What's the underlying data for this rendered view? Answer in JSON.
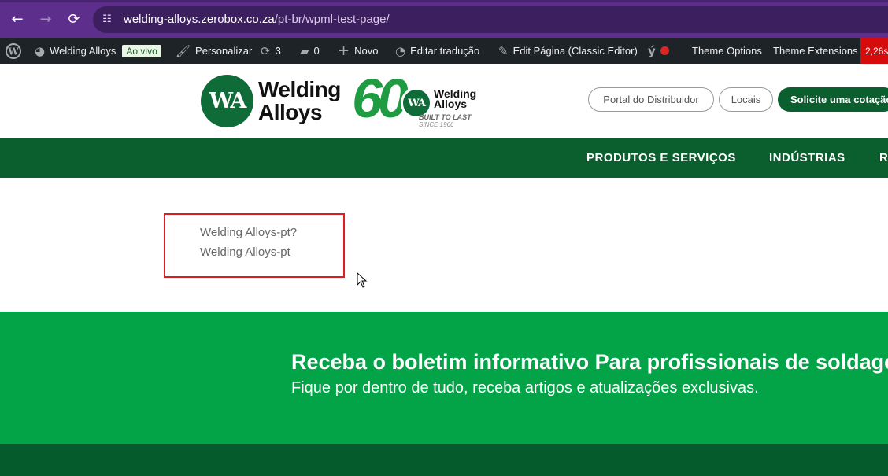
{
  "browser": {
    "url_host": "welding-alloys.zerobox.co.za",
    "url_path": "/pt-br/wpml-test-page/",
    "icons": {
      "back": "arrow-left-icon",
      "forward": "arrow-right-icon",
      "reload": "reload-icon",
      "site_info": "tune-icon"
    }
  },
  "adminbar": {
    "site_name": "Welding Alloys",
    "live_badge": "Ao vivo",
    "customize": "Personalizar",
    "updates_count": "3",
    "comments_count": "0",
    "new": "Novo",
    "edit_translation": "Editar tradução",
    "edit_page": "Edit Página (Classic Editor)",
    "theme_options": "Theme Options",
    "theme_extensions": "Theme Extensions",
    "perf": "2,26s",
    "colors": {
      "bg": "#1d2327",
      "perf_bg": "#d60c0c"
    }
  },
  "header": {
    "logo_mark": "WA",
    "logo_line1": "Welding",
    "logo_line2": "Alloys",
    "badge_number": "60",
    "badge_mark": "WA",
    "badge_line1": "Welding",
    "badge_line2": "Alloys",
    "badge_tagline": "BUILT TO LAST",
    "badge_since": "SINCE 1966",
    "buttons": {
      "distributor_portal": "Portal do Distribuidor",
      "locations": "Locais",
      "quote": "Solicite uma cotação"
    }
  },
  "nav": {
    "items": [
      "PRODUTOS E SERVIÇOS",
      "INDÚSTRIAS",
      "R"
    ]
  },
  "content": {
    "lines": [
      "Welding Alloys-pt?",
      "Welding Alloys-pt"
    ]
  },
  "newsletter": {
    "title": "Receba o boletim informativo Para profissionais de soldagem",
    "subtitle": "Fique por dentro de tudo, receba artigos e atualizações exclusivas."
  },
  "colors": {
    "chrome": "#5d2e8c",
    "brand_dark_green": "#0b5e2e",
    "brand_green": "#02a447",
    "highlight_red": "#e11b22"
  }
}
